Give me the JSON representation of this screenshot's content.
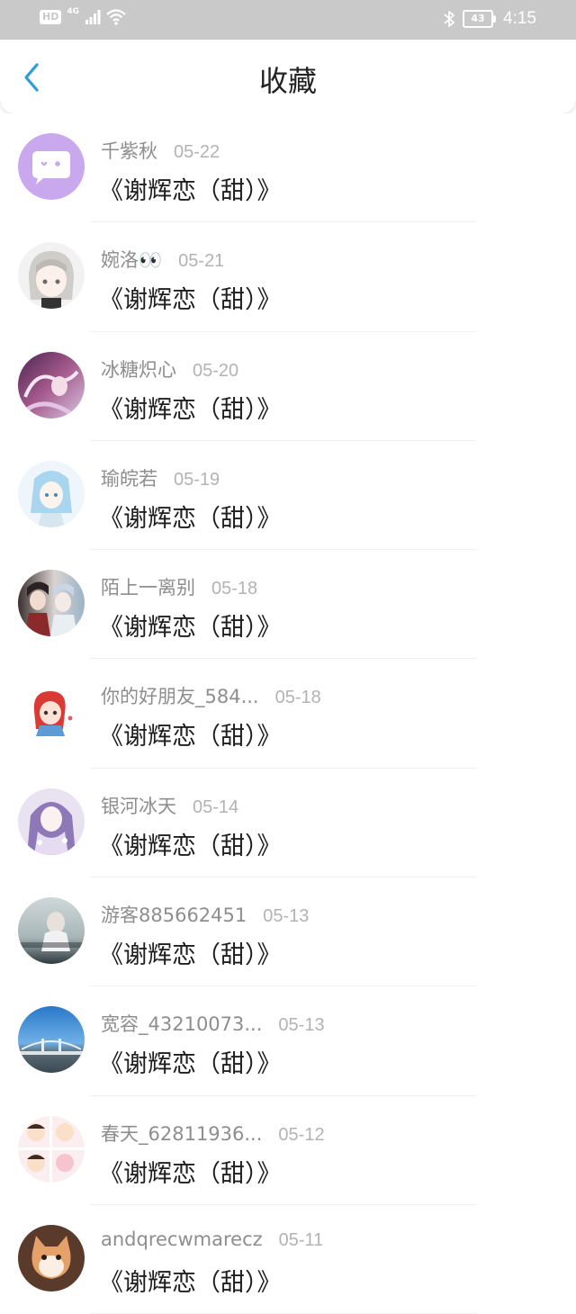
{
  "status_bar": {
    "hd": "HD",
    "network": "4G",
    "battery": "43",
    "time": "4:15"
  },
  "nav": {
    "title": "收藏",
    "back_icon": "chevron-left-icon"
  },
  "colors": {
    "accent": "#2d9cdb",
    "status_bar_bg": "#c9c9c9",
    "name_text": "#8e8e8e",
    "date_text": "#b3b3b3",
    "title_text": "#1e1e1e"
  },
  "items": [
    {
      "name": "千紫秋",
      "date": "05-22",
      "title": "《谢辉恋（甜）》",
      "avatar": "chat-bubble-avatar"
    },
    {
      "name": "婉洛👀",
      "date": "05-21",
      "title": "《谢辉恋（甜）》",
      "avatar": "anime-girl-avatar"
    },
    {
      "name": "冰糖炽心",
      "date": "05-20",
      "title": "《谢辉恋（甜）》",
      "avatar": "anime-avatar"
    },
    {
      "name": "瑜皖若",
      "date": "05-19",
      "title": "《谢辉恋（甜）》",
      "avatar": "anime-avatar"
    },
    {
      "name": "陌上一离别",
      "date": "05-18",
      "title": "《谢辉恋（甜）》",
      "avatar": "anime-avatar"
    },
    {
      "name": "你的好朋友_584...",
      "date": "05-18",
      "title": "《谢辉恋（甜）》",
      "avatar": "cartoon-girl-avatar"
    },
    {
      "name": "银河冰天",
      "date": "05-14",
      "title": "《谢辉恋（甜）》",
      "avatar": "anime-avatar"
    },
    {
      "name": "游客885662451",
      "date": "05-13",
      "title": "《谢辉恋（甜）》",
      "avatar": "photo-avatar"
    },
    {
      "name": "宽容_43210073...",
      "date": "05-13",
      "title": "《谢辉恋（甜）》",
      "avatar": "sky-bridge-avatar"
    },
    {
      "name": "春天_62811936...",
      "date": "05-12",
      "title": "《谢辉恋（甜）》",
      "avatar": "cartoon-avatar"
    },
    {
      "name": "andqrecwmarecz",
      "date": "05-11",
      "title": "《谢辉恋（甜）》",
      "avatar": "cat-avatar"
    }
  ]
}
